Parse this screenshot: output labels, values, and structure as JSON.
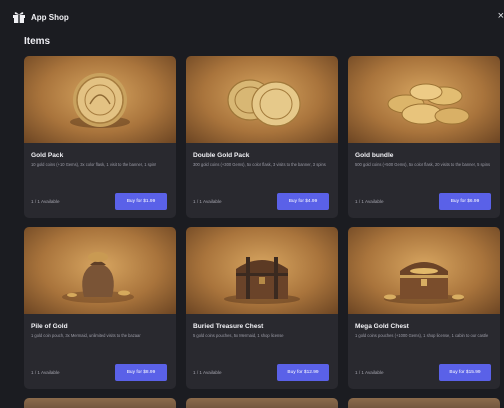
{
  "window": {
    "title": "App Shop",
    "app_icon": "gift-icon",
    "close_icon": "close-icon",
    "close_glyph": "×"
  },
  "section": {
    "title": "Items"
  },
  "accent_color": "#5a61e8",
  "items": [
    {
      "name": "Gold  Pack",
      "description": "10 gold coins (+10 Gems), 3x color flask, 1 visit to the banner, 1 spin!",
      "availability": "1 / 1 Available",
      "button": "Buy for $1.99",
      "image": "gold-coin-image"
    },
    {
      "name": "Double Gold Pack",
      "description": "300 gold coins (+300 Gems), 5x color flask, 3 visits to the banner, 3 spins",
      "availability": "1 / 1 Available",
      "button": "Buy for $4.99",
      "image": "two-gold-coins-image"
    },
    {
      "name": "Gold bundle",
      "description": "500 gold coins (+500 Gems), 5x color flask, 20 visits to the banner, 5 spins",
      "availability": "1 / 1 Available",
      "button": "Buy for $6.99",
      "image": "gold-coin-pile-image"
    },
    {
      "name": "Pile of Gold",
      "description": "1 gold coin pouch, 3x Mermaid, unlimited visits to the bazaar",
      "availability": "1 / 1 Available",
      "button": "Buy for $8.99",
      "image": "coin-sack-image"
    },
    {
      "name": "Buried Treasure Chest",
      "description": "5 gold coins pouches, 5x Mermaid, 1 shop license",
      "availability": "1 / 1 Available",
      "button": "Buy for $12.99",
      "image": "treasure-chest-image"
    },
    {
      "name": "Mega Gold Chest",
      "description": "1 gold coins pouches (+1000 Gems), 1 shop license, 1 cabin to our castle",
      "availability": "1 / 1 Available",
      "button": "Buy for $15.99",
      "image": "gold-chest-image"
    }
  ]
}
